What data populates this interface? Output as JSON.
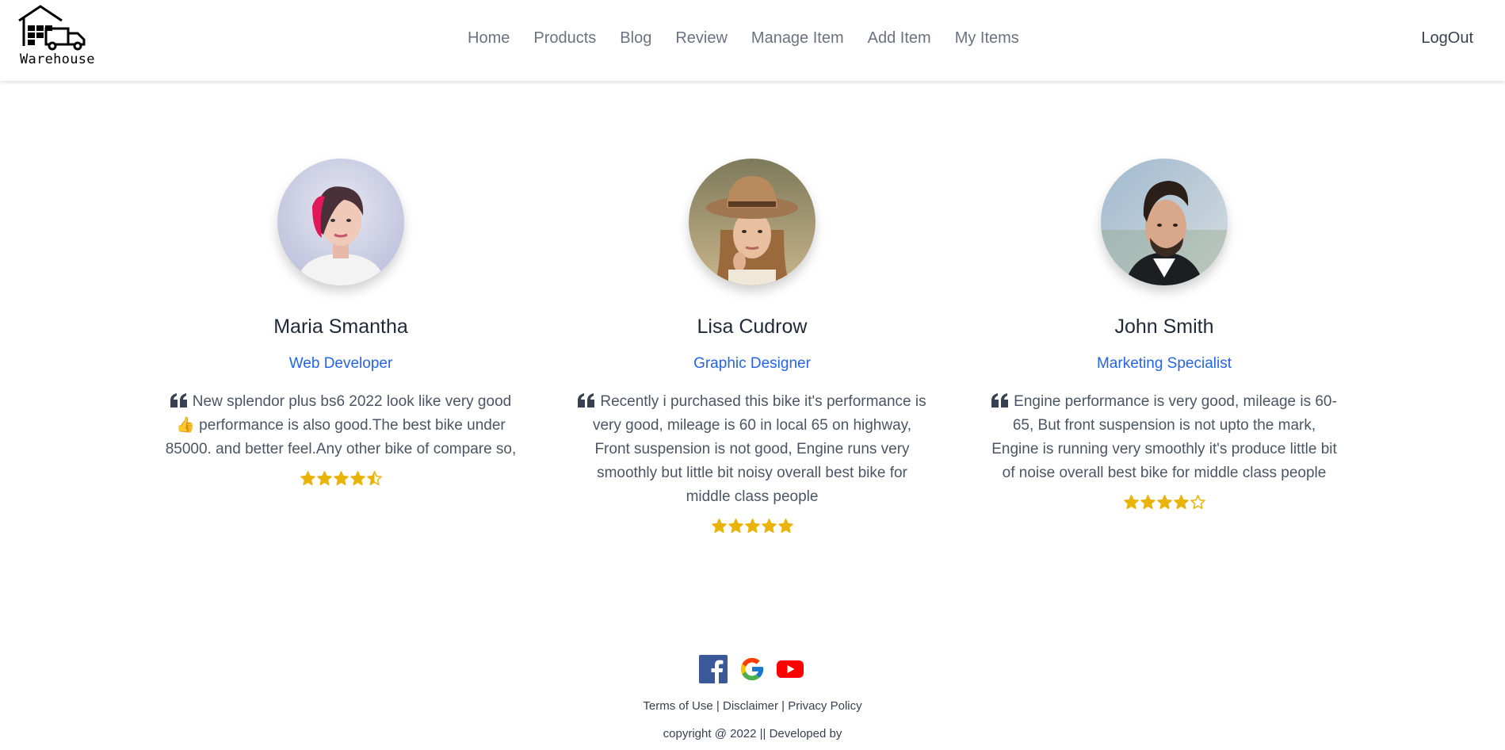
{
  "nav": {
    "brand": "Warehouse",
    "links": [
      "Home",
      "Products",
      "Blog",
      "Review",
      "Manage Item",
      "Add Item",
      "My Items"
    ],
    "logout": "LogOut"
  },
  "reviews": [
    {
      "name": "Maria Smantha",
      "role": "Web Developer",
      "quote": "New splendor plus bs6 2022 look like very good 👍 performance is also good.The best bike under 85000. and better feel.Any other bike of compare so,",
      "rating": 4.5
    },
    {
      "name": "Lisa Cudrow",
      "role": "Graphic Designer",
      "quote": "Recently i purchased this bike it's performance is very good, mileage is 60 in local 65 on highway, Front suspension is not good, Engine runs very smoothly but little bit noisy overall best bike for middle class people",
      "rating": 5
    },
    {
      "name": "John Smith",
      "role": "Marketing Specialist",
      "quote": "Engine performance is very good, mileage is 60-65, But front suspension is not upto the mark, Engine is running very smoothly it's produce little bit of noise overall best bike for middle class people",
      "rating": 4
    }
  ],
  "footer": {
    "social_icons": [
      "facebook-icon",
      "google-icon",
      "youtube-icon"
    ],
    "links": [
      "Terms of Use",
      "Disclaimer",
      "Privacy Policy"
    ],
    "copyright": "copyright @ 2022 || Developed by"
  },
  "colors": {
    "accent": "#2563eb",
    "star": "#eab308",
    "facebook": "#3b5998",
    "youtube": "#ff0000"
  }
}
